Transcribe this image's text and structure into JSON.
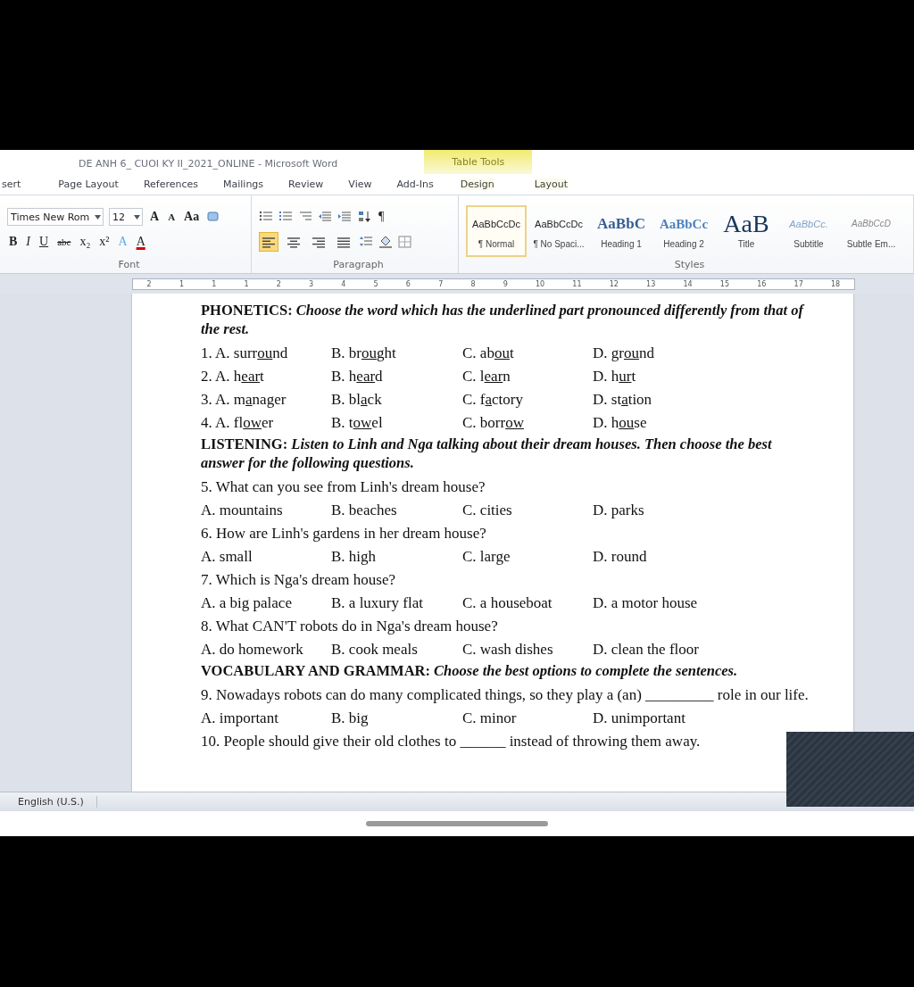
{
  "window": {
    "title": "DE ANH 6_ CUOI KY II_2021_ONLINE - Microsoft Word",
    "context_tab": "Table Tools"
  },
  "ribbon_tabs": [
    {
      "label": "sert",
      "selected": false
    },
    {
      "label": "Page Layout",
      "selected": false
    },
    {
      "label": "References",
      "selected": false
    },
    {
      "label": "Mailings",
      "selected": false
    },
    {
      "label": "Review",
      "selected": false
    },
    {
      "label": "View",
      "selected": false
    },
    {
      "label": "Add-Ins",
      "selected": false
    },
    {
      "label": "Design",
      "selected": false
    },
    {
      "label": "Layout",
      "selected": false
    }
  ],
  "font_group": {
    "font_name": "Times New Rom",
    "font_size": "12",
    "label": "Font",
    "row1": [
      {
        "kind": "grow",
        "label": "A"
      },
      {
        "kind": "shrink",
        "label": "A"
      },
      {
        "kind": "case",
        "label": "Aa"
      }
    ],
    "row2": [
      {
        "kind": "bold",
        "label": "B"
      },
      {
        "kind": "italic",
        "label": "I"
      },
      {
        "kind": "underline",
        "label": "U"
      },
      {
        "kind": "strike",
        "label": "abc"
      },
      {
        "kind": "sub",
        "label": "x₂"
      },
      {
        "kind": "sup",
        "label": "x²"
      },
      {
        "kind": "effects",
        "label": "A"
      },
      {
        "kind": "color",
        "label": "A"
      }
    ]
  },
  "paragraph_group": {
    "label": "Paragraph",
    "pilcrow": "¶",
    "alignments": [
      {
        "kind": "left",
        "selected": true
      },
      {
        "kind": "center",
        "selected": false
      },
      {
        "kind": "right",
        "selected": false
      },
      {
        "kind": "justify",
        "selected": false
      }
    ]
  },
  "styles_group": {
    "label": "Styles",
    "styles": [
      {
        "preview": "AaBbCcDc",
        "name": "¶ Normal",
        "kind": "normal",
        "selected": true
      },
      {
        "preview": "AaBbCcDc",
        "name": "¶ No Spaci...",
        "kind": "normal",
        "selected": false
      },
      {
        "preview": "AaBbC",
        "name": "Heading 1",
        "kind": "heading1",
        "selected": false
      },
      {
        "preview": "AaBbCc",
        "name": "Heading 2",
        "kind": "heading2",
        "selected": false
      },
      {
        "preview": "AaB",
        "name": "Title",
        "kind": "title",
        "selected": false
      },
      {
        "preview": "AaBbCc.",
        "name": "Subtitle",
        "kind": "subtitle",
        "selected": false
      },
      {
        "preview": "AaBbCcD",
        "name": "Subtle Em...",
        "kind": "subtle",
        "selected": false
      }
    ]
  },
  "ruler": [
    "2",
    "1",
    "1",
    "1",
    "2",
    "3",
    "4",
    "5",
    "6",
    "7",
    "8",
    "9",
    "10",
    "11",
    "12",
    "13",
    "14",
    "15",
    "16",
    "17",
    "18"
  ],
  "document": [
    {
      "kind": "heading",
      "title": "PHONETICS:",
      "instruction": "Choose the word which has the underlined part pronounced differently from that of the rest."
    },
    {
      "kind": "options",
      "options": [
        [
          "1. A. surr",
          "ou",
          "nd"
        ],
        [
          "B. br",
          "ou",
          "ght"
        ],
        [
          "C. ab",
          "ou",
          "t"
        ],
        [
          "D. gr",
          "ou",
          "nd"
        ]
      ]
    },
    {
      "kind": "options",
      "options": [
        [
          "2. A. h",
          "ear",
          "t"
        ],
        [
          "B. h",
          "ear",
          "d"
        ],
        [
          "C. l",
          "ear",
          "n"
        ],
        [
          "D. h",
          "ur",
          "t"
        ]
      ]
    },
    {
      "kind": "options",
      "options": [
        [
          "3. A. m",
          "a",
          "nager"
        ],
        [
          "B. bl",
          "a",
          "ck"
        ],
        [
          "C. f",
          "a",
          "ctory"
        ],
        [
          "D. st",
          "a",
          "tion"
        ]
      ]
    },
    {
      "kind": "options",
      "options": [
        [
          "4. A. fl",
          "ow",
          "er"
        ],
        [
          "B. t",
          "ow",
          "el"
        ],
        [
          "C. borr",
          "ow"
        ],
        [
          "D. h",
          "ou",
          "se"
        ]
      ]
    },
    {
      "kind": "heading",
      "title": "LISTENING:",
      "instruction": "Listen to Linh and Nga talking about their dream houses. Then choose the best answer for the following questions."
    },
    {
      "kind": "question",
      "text": "5. What can you see from Linh's dream house?"
    },
    {
      "kind": "options",
      "options": [
        [
          "A. mountains"
        ],
        [
          "B. beaches"
        ],
        [
          "C. cities"
        ],
        [
          "D. parks"
        ]
      ]
    },
    {
      "kind": "question",
      "text": "6. How are Linh's gardens in her dream house?"
    },
    {
      "kind": "options",
      "options": [
        [
          "A. small"
        ],
        [
          "B. high"
        ],
        [
          "C. large"
        ],
        [
          "D. round"
        ]
      ]
    },
    {
      "kind": "question",
      "text": "7. Which is Nga's dream house?"
    },
    {
      "kind": "options",
      "options": [
        [
          "A. a big palace"
        ],
        [
          "B. a luxury flat"
        ],
        [
          "C. a houseboat"
        ],
        [
          "D. a motor house"
        ]
      ]
    },
    {
      "kind": "question",
      "text": "8. What CAN'T robots do in Nga's dream house?"
    },
    {
      "kind": "options",
      "options": [
        [
          "A. do homework"
        ],
        [
          "B. cook meals"
        ],
        [
          "C. wash dishes"
        ],
        [
          "D. clean the floor"
        ]
      ]
    },
    {
      "kind": "heading",
      "title": "VOCABULARY AND GRAMMAR:",
      "instruction": "Choose the best options to complete the sentences."
    },
    {
      "kind": "question",
      "text": "9. Nowadays robots can do many complicated things, so they play a (an) _________ role in our life."
    },
    {
      "kind": "options",
      "options": [
        [
          "A. important"
        ],
        [
          "B. big"
        ],
        [
          "C. minor"
        ],
        [
          "D. unimportant"
        ]
      ]
    },
    {
      "kind": "question",
      "text": "10. People should give their old clothes to ______ instead of throwing them away."
    }
  ],
  "status_bar": {
    "language": "English (U.S.)"
  }
}
